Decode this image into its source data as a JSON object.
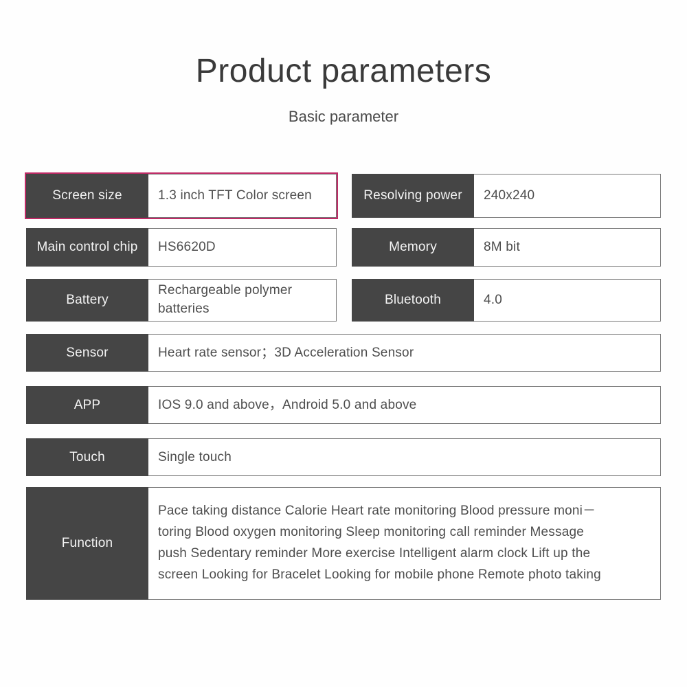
{
  "header": {
    "title": "Product parameters",
    "subtitle": "Basic parameter"
  },
  "colors": {
    "label_background": "#454545",
    "label_text": "#f4f4f4",
    "value_text": "#4d4d4d",
    "value_border": "#777777",
    "highlight_border": "#c02a66",
    "page_background": "#fefefe"
  },
  "table": {
    "rows": [
      {
        "label": "Screen size",
        "value": "1.3  inch TFT Color screen",
        "span": "half",
        "column": "left",
        "highlighted": true
      },
      {
        "label": "Resolving power",
        "value": "240x240",
        "span": "half",
        "column": "right",
        "highlighted": false
      },
      {
        "label": "Main control chip",
        "value": "HS6620D",
        "span": "half",
        "column": "left",
        "highlighted": false
      },
      {
        "label": "Memory",
        "value": "8M bit",
        "span": "half",
        "column": "right",
        "highlighted": false
      },
      {
        "label": "Battery",
        "value": "Rechargeable polymer\nbatteries",
        "span": "half",
        "column": "left",
        "highlighted": false
      },
      {
        "label": "Bluetooth",
        "value": "4.0",
        "span": "half",
        "column": "right",
        "highlighted": false
      },
      {
        "label": "Sensor",
        "value": "Heart rate sensor；3D Acceleration Sensor",
        "span": "full",
        "column": "full",
        "highlighted": false
      },
      {
        "label": "APP",
        "value": "IOS 9.0 and above，Android 5.0 and above",
        "span": "full",
        "column": "full",
        "highlighted": false
      },
      {
        "label": "Touch",
        "value": "Single touch",
        "span": "full",
        "column": "full",
        "highlighted": false
      },
      {
        "label": "Function",
        "value": "Pace taking  distance  Calorie  Heart rate monitoring  Blood pressure moni－\ntoring  Blood oxygen monitoring  Sleep monitoring  call reminder  Message\npush  Sedentary reminder  More exercise  Intelligent alarm clock Lift up the\nscreen  Looking for Bracelet  Looking for mobile phone  Remote photo taking",
        "span": "full",
        "column": "full",
        "highlighted": false
      }
    ]
  }
}
